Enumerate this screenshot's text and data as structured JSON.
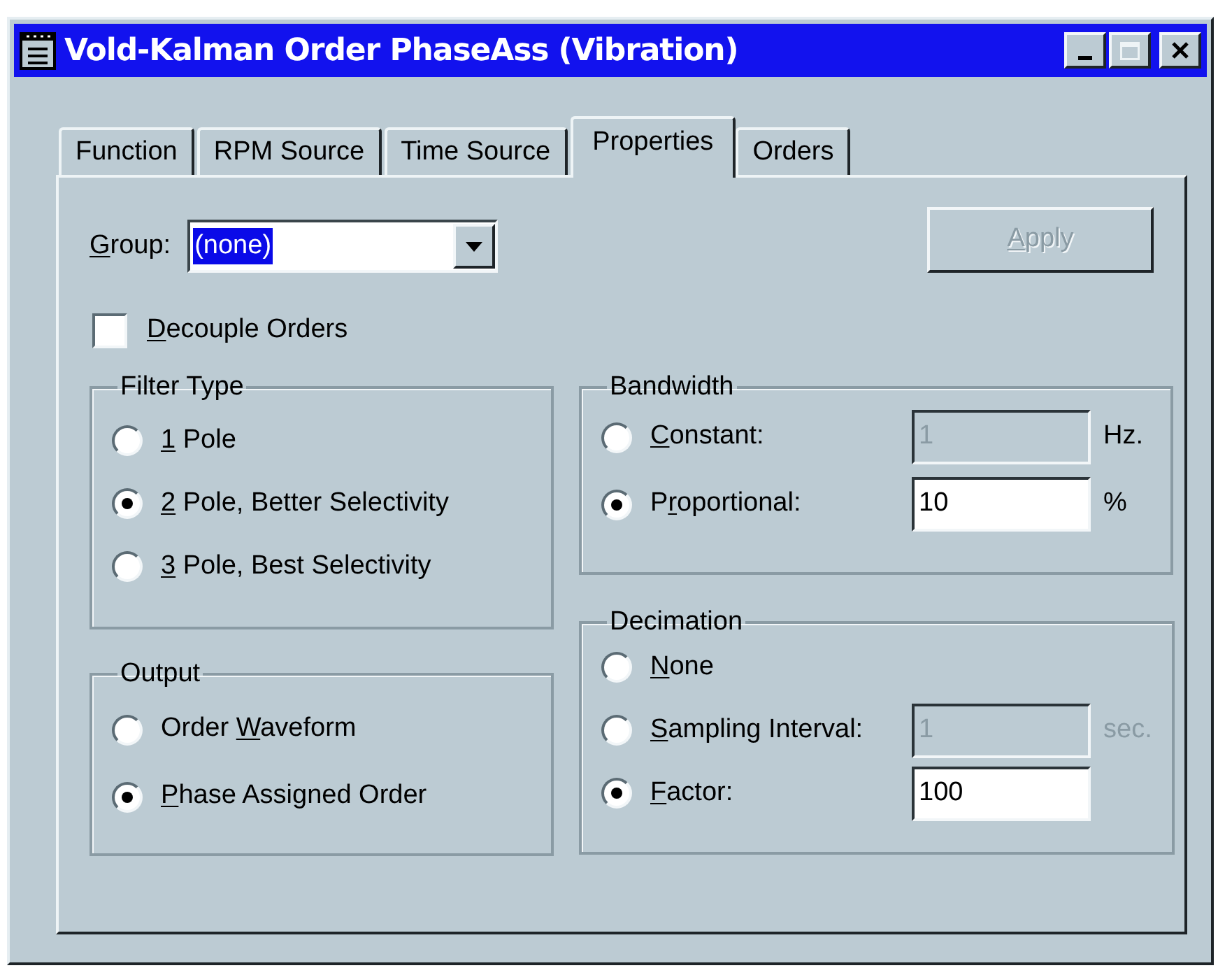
{
  "window": {
    "title": "Vold-Kalman Order PhaseAss (Vibration)",
    "controls": [
      {
        "kind": "minimize",
        "disabled": false
      },
      {
        "kind": "maximize",
        "disabled": true
      },
      {
        "kind": "close",
        "disabled": false
      }
    ]
  },
  "tabs": [
    {
      "label": "Function",
      "selected": false
    },
    {
      "label": "RPM Source",
      "selected": false
    },
    {
      "label": "Time Source",
      "selected": false
    },
    {
      "label": "Properties",
      "selected": true
    },
    {
      "label": "Orders",
      "selected": false
    }
  ],
  "group": {
    "label": {
      "key": "G",
      "post": "roup:"
    },
    "value": "(none)",
    "text_selected": true
  },
  "apply_button": {
    "label": {
      "key": "A",
      "post": "pply"
    },
    "disabled": true
  },
  "decouple_orders": {
    "label": {
      "key": "D",
      "post": "ecouple Orders"
    },
    "checked": false
  },
  "filter_type": {
    "title": "Filter Type",
    "options": [
      {
        "label": {
          "key": "1",
          "post": " Pole"
        },
        "selected": false
      },
      {
        "label": {
          "key": "2",
          "post": " Pole, Better Selectivity"
        },
        "selected": true
      },
      {
        "label": {
          "key": "3",
          "post": " Pole, Best Selectivity"
        },
        "selected": false
      }
    ]
  },
  "output": {
    "title": "Output",
    "options": [
      {
        "label": {
          "pre": "Order ",
          "key": "W",
          "post": "aveform"
        },
        "selected": false
      },
      {
        "label": {
          "key": "P",
          "post": "hase Assigned Order"
        },
        "selected": true
      }
    ]
  },
  "bandwidth": {
    "title": "Bandwidth",
    "options": [
      {
        "label": {
          "key": "C",
          "post": "onstant:"
        },
        "selected": false,
        "field": {
          "value": "1",
          "disabled": true
        },
        "unit": {
          "text": "Hz.",
          "disabled": false
        }
      },
      {
        "label": {
          "pre": "P",
          "key": "r",
          "post": "oportional:"
        },
        "selected": true,
        "field": {
          "value": "10",
          "disabled": false
        },
        "unit": {
          "text": "%",
          "disabled": false
        }
      }
    ]
  },
  "decimation": {
    "title": "Decimation",
    "options": [
      {
        "label": {
          "key": "N",
          "post": "one"
        },
        "selected": false
      },
      {
        "label": {
          "key": "S",
          "post": "ampling Interval:"
        },
        "selected": false,
        "field": {
          "value": "1",
          "disabled": true
        },
        "unit": {
          "text": "sec.",
          "disabled": true
        }
      },
      {
        "label": {
          "key": "F",
          "post": "actor:"
        },
        "selected": true,
        "field": {
          "value": "100",
          "disabled": false
        }
      }
    ]
  }
}
